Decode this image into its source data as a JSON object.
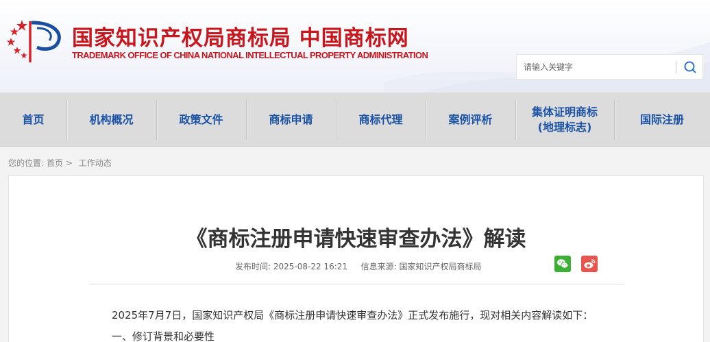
{
  "header": {
    "site_title_cn": "国家知识产权局商标局 中国商标网",
    "site_title_en": "TRADEMARK OFFICE OF CHINA NATIONAL INTELLECTUAL PROPERTY ADMINISTRATION",
    "brand_color": "#c8161d",
    "search": {
      "placeholder": "请输入关键字",
      "icon": "search-icon"
    }
  },
  "nav": {
    "items": [
      {
        "label": "首页"
      },
      {
        "label": "机构概况"
      },
      {
        "label": "政策文件"
      },
      {
        "label": "商标申请"
      },
      {
        "label": "商标代理"
      },
      {
        "label": "案例评析"
      },
      {
        "label": "集体证明商标",
        "label2": "(地理标志)"
      },
      {
        "label": "国际注册"
      }
    ],
    "color": "#1a52a6"
  },
  "breadcrumb": {
    "prefix": "您的位置:",
    "home": "首页",
    "separator": ">",
    "current": "工作动态"
  },
  "article": {
    "title": "《商标注册申请快速审查办法》解读",
    "publish_label": "发布时间:",
    "publish_time": "2025-08-22 16:21",
    "source_label": "信息来源:",
    "source": "国家知识产权局商标局",
    "share": {
      "wechat_icon": "wechat-icon",
      "weibo_icon": "weibo-icon"
    },
    "paragraphs": [
      "2025年7月7日，国家知识产权局《商标注册申请快速审查办法》正式发布施行，现对相关内容解读如下：",
      "一、修订背景和必要性"
    ]
  }
}
